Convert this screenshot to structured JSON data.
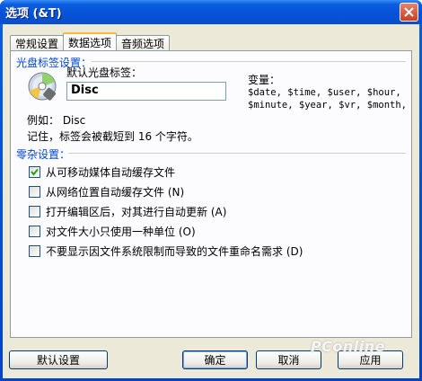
{
  "window": {
    "title": "选项 (&T)"
  },
  "tabs": [
    {
      "label": "常规设置"
    },
    {
      "label": "数据选项"
    },
    {
      "label": "音频选项"
    }
  ],
  "disc_label_group": {
    "title": "光盘标签设置：",
    "default_label": "默认光盘标签：",
    "input_value": "Disc",
    "variables_title": "变量：",
    "variables_line1": "$date, $time, $user, $hour,",
    "variables_line2": "$minute, $year, $vr, $month,",
    "example": "例如： Disc",
    "note": "记住，标签会被截短到 16 个字符。"
  },
  "misc_group": {
    "title": "零杂设置：",
    "options": [
      {
        "label": "从可移动媒体自动缓存文件",
        "checked": true
      },
      {
        "label": "从网络位置自动缓存文件 (N)",
        "checked": false
      },
      {
        "label": "打开编辑区后，对其进行自动更新 (A)",
        "checked": false
      },
      {
        "label": "对文件大小只使用一种单位 (O)",
        "checked": false
      },
      {
        "label": "不要显示因文件系统限制而导致的文件重命名需求 (D)",
        "checked": false
      }
    ]
  },
  "buttons": {
    "defaults": "默认设置",
    "ok": "确定",
    "cancel": "取消",
    "apply": "应用"
  },
  "watermark": "PConline"
}
